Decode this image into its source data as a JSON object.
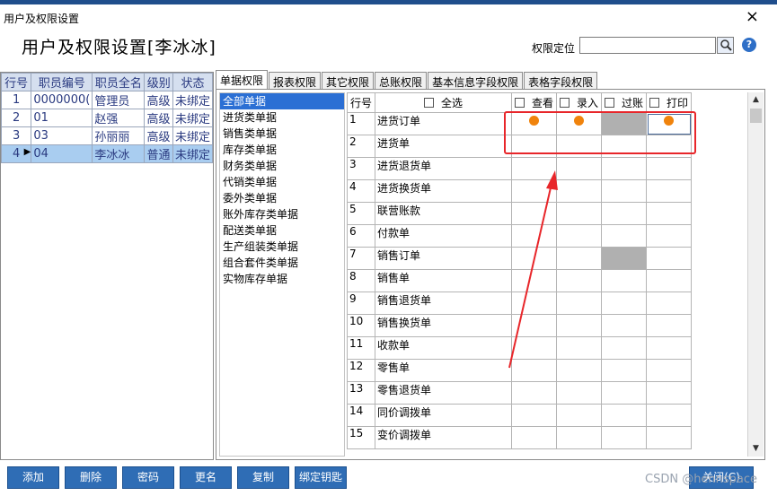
{
  "window": {
    "title": "用户及权限设置",
    "close_glyph": "×"
  },
  "heading": "用户及权限设置[李冰冰]",
  "locate": {
    "label": "权限定位",
    "value": ""
  },
  "help_glyph": "?",
  "employees": {
    "columns": [
      "行号",
      "职员编号",
      "职员全名",
      "级别",
      "状态"
    ],
    "rows": [
      {
        "no": "1",
        "code": "0000000(",
        "name": "管理员",
        "level": "高级",
        "status": "未绑定"
      },
      {
        "no": "2",
        "code": "01",
        "name": "赵强",
        "level": "高级",
        "status": "未绑定"
      },
      {
        "no": "3",
        "code": "03",
        "name": "孙丽丽",
        "level": "高级",
        "status": "未绑定"
      },
      {
        "no": "4",
        "code": "04",
        "name": "李冰冰",
        "level": "普通",
        "status": "未绑定"
      }
    ]
  },
  "tabs": [
    "单据权限",
    "报表权限",
    "其它权限",
    "总账权限",
    "基本信息字段权限",
    "表格字段权限"
  ],
  "categories": [
    "全部单据",
    "进货类单据",
    "销售类单据",
    "库存类单据",
    "财务类单据",
    "代销类单据",
    "委外类单据",
    "账外库存类单据",
    "配送类单据",
    "生产组装类单据",
    "组合套件类单据",
    "实物库存单据"
  ],
  "grid": {
    "header": {
      "rowno": "行号",
      "select_all": "全选",
      "view": "查看",
      "entry": "录入",
      "post": "过账",
      "print": "打印"
    },
    "rows": [
      {
        "no": "1",
        "name": "进货订单"
      },
      {
        "no": "2",
        "name": "进货单"
      },
      {
        "no": "3",
        "name": "进货退货单"
      },
      {
        "no": "4",
        "name": "进货换货单"
      },
      {
        "no": "5",
        "name": "联营账款"
      },
      {
        "no": "6",
        "name": "付款单"
      },
      {
        "no": "7",
        "name": "销售订单"
      },
      {
        "no": "8",
        "name": "销售单"
      },
      {
        "no": "9",
        "name": "销售退货单"
      },
      {
        "no": "10",
        "name": "销售换货单"
      },
      {
        "no": "11",
        "name": "收款单"
      },
      {
        "no": "12",
        "name": "零售单"
      },
      {
        "no": "13",
        "name": "零售退货单"
      },
      {
        "no": "14",
        "name": "同价调拨单"
      },
      {
        "no": "15",
        "name": "变价调拨单"
      }
    ]
  },
  "scroll": {
    "up": "▲",
    "down": "▼"
  },
  "buttons": {
    "add": "添加",
    "delete": "删除",
    "password": "密码",
    "rename": "更名",
    "copy": "复制",
    "bind_key": "绑定钥匙",
    "close": "关闭(C)"
  },
  "watermark": "CSDN @hennspace",
  "colors": {
    "accent": "#2f6db5",
    "highlight_box": "#e8262a",
    "dot": "#f0830c",
    "disabled_cell": "#b0b0b0"
  }
}
